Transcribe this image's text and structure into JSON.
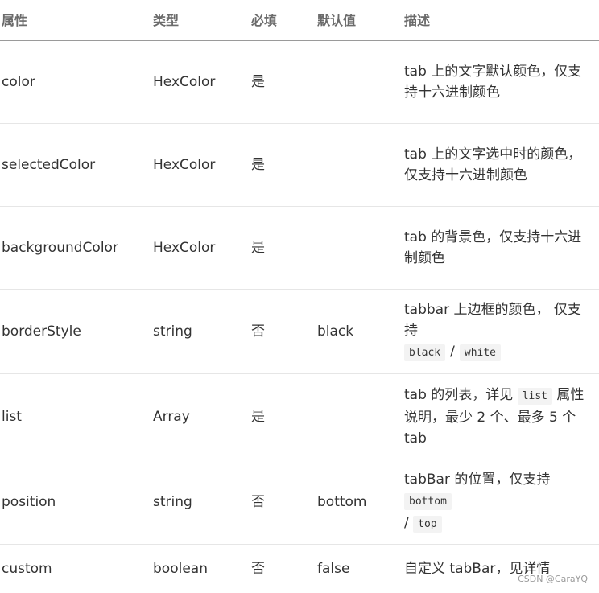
{
  "headers": [
    "属性",
    "类型",
    "必填",
    "默认值",
    "描述"
  ],
  "rows": [
    {
      "attr": "color",
      "type": "HexColor",
      "required": "是",
      "default": "",
      "desc": [
        "tab 上的文字默认颜色，仅支持十六进制颜色"
      ]
    },
    {
      "attr": "selectedColor",
      "type": "HexColor",
      "required": "是",
      "default": "",
      "desc": [
        "tab 上的文字选中时的颜色，仅支持十六进制颜色"
      ]
    },
    {
      "attr": "backgroundColor",
      "type": "HexColor",
      "required": "是",
      "default": "",
      "desc": [
        "tab 的背景色，仅支持十六进制颜色"
      ]
    },
    {
      "attr": "borderStyle",
      "type": "string",
      "required": "否",
      "default": "black",
      "desc": [
        "tabbar 上边框的颜色， 仅支持"
      ],
      "codes": [
        "black",
        "white"
      ],
      "code_sep": "/"
    },
    {
      "attr": "list",
      "type": "Array",
      "required": "是",
      "default": "",
      "desc_parts": [
        "tab 的列表，详见 ",
        "list",
        " 属性说明，最少 2 个、最多 5 个 tab"
      ]
    },
    {
      "attr": "position",
      "type": "string",
      "required": "否",
      "default": "bottom",
      "desc_parts": [
        "tabBar 的位置，仅支持 ",
        "bottom",
        " / ",
        "top",
        ""
      ]
    },
    {
      "attr": "custom",
      "type": "boolean",
      "required": "否",
      "default": "false",
      "desc": [
        "自定义 tabBar，见详情"
      ]
    }
  ],
  "watermark": "CSDN @CaraYQ"
}
